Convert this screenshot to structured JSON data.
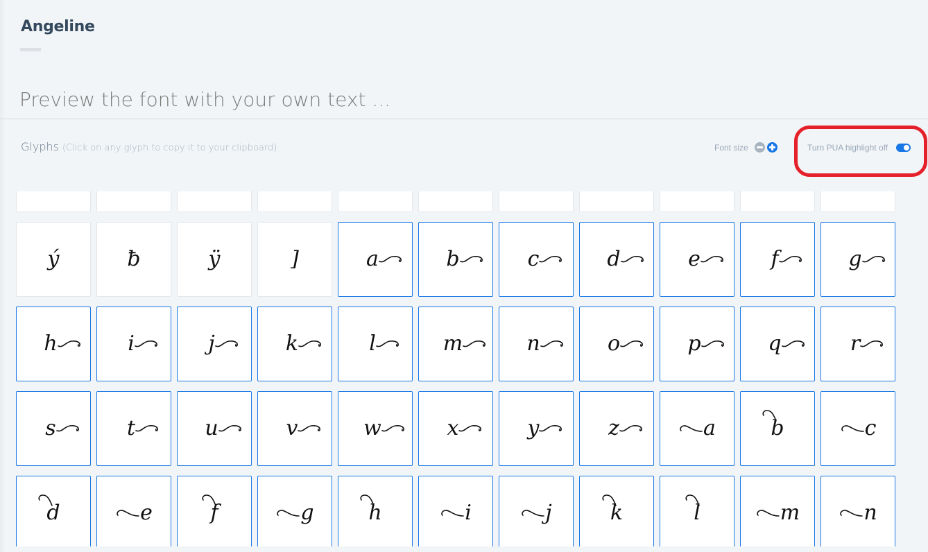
{
  "header": {
    "font_name": "Angeline",
    "preview_placeholder": "Preview the font with your own text ..."
  },
  "glyphs_section": {
    "label": "Glyphs",
    "hint": "(Click on any glyph to copy it to your clipboard)",
    "font_size_label": "Font size",
    "font_size_decrease_icon": "minus-circle-icon",
    "font_size_increase_icon": "plus-circle-icon",
    "pua_toggle_label": "Turn PUA highlight off",
    "pua_toggle_on": true
  },
  "colors": {
    "accent": "#1877e5",
    "annotation": "#e4202b",
    "title": "#34495e"
  },
  "glyph_rows": [
    [
      {
        "char": "",
        "pua": false,
        "swash": "none"
      },
      {
        "char": "",
        "pua": false,
        "swash": "none"
      },
      {
        "char": "",
        "pua": false,
        "swash": "none"
      },
      {
        "char": "",
        "pua": false,
        "swash": "none"
      },
      {
        "char": "",
        "pua": false,
        "swash": "none"
      },
      {
        "char": "",
        "pua": false,
        "swash": "none"
      },
      {
        "char": "",
        "pua": false,
        "swash": "none"
      },
      {
        "char": "",
        "pua": false,
        "swash": "none"
      },
      {
        "char": "",
        "pua": false,
        "swash": "none"
      },
      {
        "char": "",
        "pua": false,
        "swash": "none"
      },
      {
        "char": "",
        "pua": false,
        "swash": "none"
      }
    ],
    [
      {
        "char": "ý",
        "pua": false,
        "swash": "none"
      },
      {
        "char": "ƀ",
        "pua": false,
        "swash": "none"
      },
      {
        "char": "ÿ",
        "pua": false,
        "swash": "none"
      },
      {
        "char": "]",
        "pua": false,
        "swash": "none"
      },
      {
        "char": "a",
        "pua": true,
        "swash": "tail"
      },
      {
        "char": "b",
        "pua": true,
        "swash": "tail"
      },
      {
        "char": "c",
        "pua": true,
        "swash": "tail"
      },
      {
        "char": "d",
        "pua": true,
        "swash": "tail"
      },
      {
        "char": "e",
        "pua": true,
        "swash": "tail"
      },
      {
        "char": "f",
        "pua": true,
        "swash": "tail"
      },
      {
        "char": "g",
        "pua": true,
        "swash": "tail"
      }
    ],
    [
      {
        "char": "h",
        "pua": true,
        "swash": "tail"
      },
      {
        "char": "i",
        "pua": true,
        "swash": "tail"
      },
      {
        "char": "j",
        "pua": true,
        "swash": "tail"
      },
      {
        "char": "k",
        "pua": true,
        "swash": "tail"
      },
      {
        "char": "l",
        "pua": true,
        "swash": "tail"
      },
      {
        "char": "m",
        "pua": true,
        "swash": "tail"
      },
      {
        "char": "n",
        "pua": true,
        "swash": "tail"
      },
      {
        "char": "o",
        "pua": true,
        "swash": "tail"
      },
      {
        "char": "p",
        "pua": true,
        "swash": "tail"
      },
      {
        "char": "q",
        "pua": true,
        "swash": "tail"
      },
      {
        "char": "r",
        "pua": true,
        "swash": "tail"
      }
    ],
    [
      {
        "char": "s",
        "pua": true,
        "swash": "tail"
      },
      {
        "char": "t",
        "pua": true,
        "swash": "tail"
      },
      {
        "char": "u",
        "pua": true,
        "swash": "tail"
      },
      {
        "char": "v",
        "pua": true,
        "swash": "tail"
      },
      {
        "char": "w",
        "pua": true,
        "swash": "tail"
      },
      {
        "char": "x",
        "pua": true,
        "swash": "tail"
      },
      {
        "char": "y",
        "pua": true,
        "swash": "tail"
      },
      {
        "char": "z",
        "pua": true,
        "swash": "tail"
      },
      {
        "char": "a",
        "pua": true,
        "swash": "lead"
      },
      {
        "char": "b",
        "pua": true,
        "swash": "top"
      },
      {
        "char": "c",
        "pua": true,
        "swash": "lead"
      }
    ],
    [
      {
        "char": "d",
        "pua": true,
        "swash": "top"
      },
      {
        "char": "e",
        "pua": true,
        "swash": "lead"
      },
      {
        "char": "f",
        "pua": true,
        "swash": "top"
      },
      {
        "char": "g",
        "pua": true,
        "swash": "lead"
      },
      {
        "char": "h",
        "pua": true,
        "swash": "top"
      },
      {
        "char": "i",
        "pua": true,
        "swash": "lead"
      },
      {
        "char": "j",
        "pua": true,
        "swash": "lead"
      },
      {
        "char": "k",
        "pua": true,
        "swash": "top"
      },
      {
        "char": "l",
        "pua": true,
        "swash": "top"
      },
      {
        "char": "m",
        "pua": true,
        "swash": "lead"
      },
      {
        "char": "n",
        "pua": true,
        "swash": "lead"
      }
    ]
  ]
}
